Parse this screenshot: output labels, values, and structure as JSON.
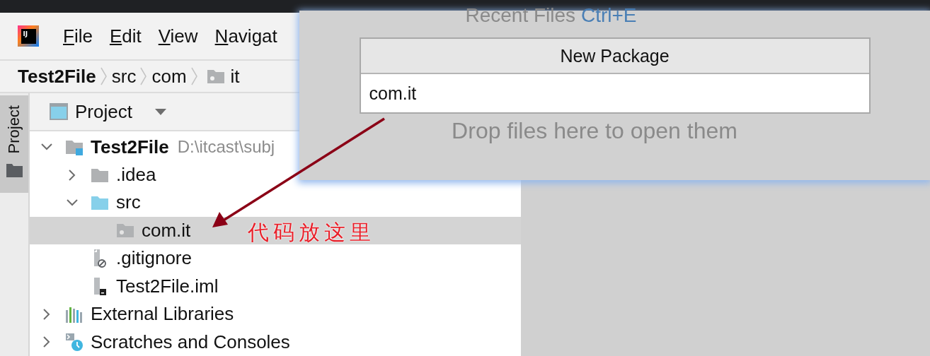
{
  "app": {
    "logo": "IJ",
    "menu": [
      {
        "label": "File"
      },
      {
        "label": "Edit"
      },
      {
        "label": "View"
      },
      {
        "label": "Navigat"
      }
    ]
  },
  "breadcrumb": [
    {
      "label": "Test2File",
      "kind": "project"
    },
    {
      "label": "src",
      "kind": "dir"
    },
    {
      "label": "com",
      "kind": "dir"
    },
    {
      "label": "it",
      "kind": "package"
    }
  ],
  "side_stripe": {
    "tab": "Project",
    "selected": true
  },
  "project_view": {
    "title": "Project",
    "tree": [
      {
        "label": "Test2File",
        "path": "D:\\itcast\\subj",
        "kind": "module",
        "expanded": true,
        "selected": false,
        "children": [
          {
            "label": ".idea",
            "kind": "folder",
            "expanded": false,
            "selected": false
          },
          {
            "label": "src",
            "kind": "source",
            "expanded": true,
            "selected": false,
            "children": [
              {
                "label": "com.it",
                "kind": "package",
                "selected": true
              }
            ]
          },
          {
            "label": ".gitignore",
            "kind": "ignore-file",
            "selected": false
          },
          {
            "label": "Test2File.iml",
            "kind": "iml-file",
            "selected": false
          }
        ]
      },
      {
        "label": "External Libraries",
        "kind": "libraries",
        "expanded": false,
        "selected": false
      },
      {
        "label": "Scratches and Consoles",
        "kind": "scratches",
        "expanded": false,
        "selected": false
      }
    ]
  },
  "popup": {
    "hint": "Recent Files",
    "shortcut": "Ctrl+E",
    "dialog": {
      "title": "New Package",
      "value": "com.it"
    },
    "drop_hint": "Drop files here to open them"
  },
  "annotation": {
    "text": "代码放这里"
  }
}
